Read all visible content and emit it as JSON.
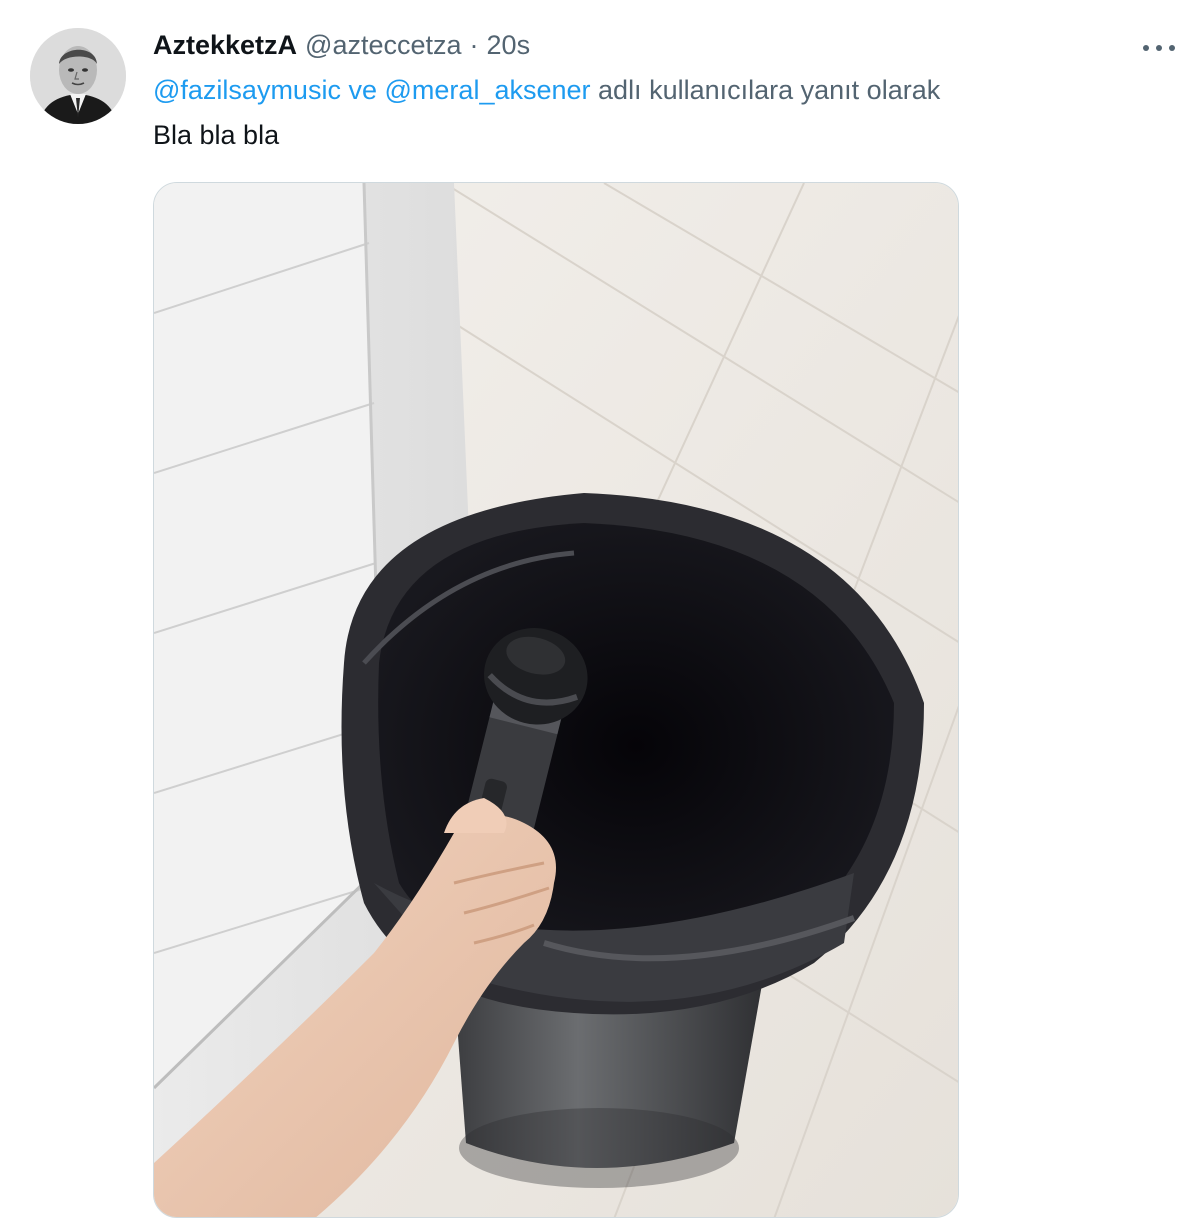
{
  "tweet": {
    "display_name": "AztekketzA",
    "handle": "@azteccetza",
    "separator": "·",
    "time": "20s",
    "reply_to": {
      "mention_1": "@fazilsaymusic",
      "conjunction": "ve",
      "mention_2": "@meral_aksener",
      "suffix": "adlı kullanıcılara yanıt olarak"
    },
    "text": "Bla bla bla"
  },
  "icons": {
    "avatar": "profile-photo",
    "more": "more-horizontal-icon"
  },
  "colors": {
    "link": "#1d9bf0",
    "secondary_text": "#536471",
    "primary_text": "#0f1419",
    "media_border": "#cfd9de"
  }
}
